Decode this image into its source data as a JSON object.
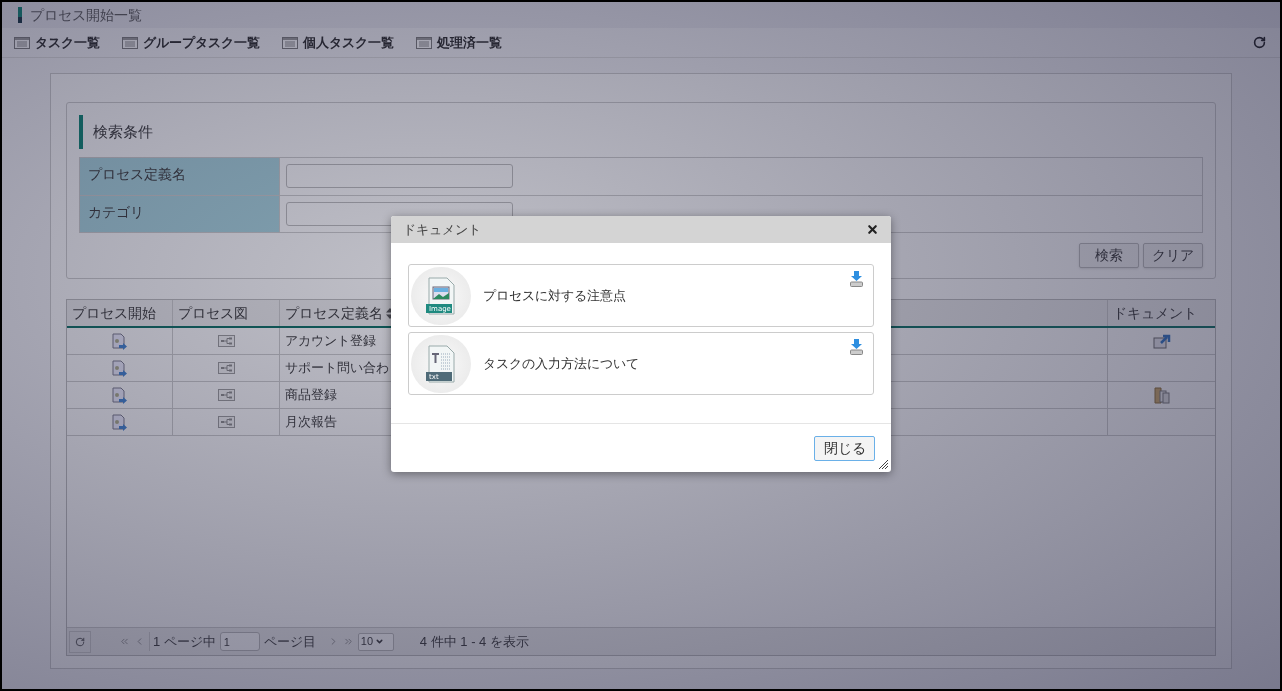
{
  "header": {
    "title": "プロセス開始一覧"
  },
  "toolbar": {
    "links": [
      "タスク一覧",
      "グループタスク一覧",
      "個人タスク一覧",
      "処理済一覧"
    ]
  },
  "search": {
    "title": "検索条件",
    "fields": [
      {
        "label": "プロセス定義名"
      },
      {
        "label": "カテゴリ"
      }
    ],
    "buttons": [
      "検索",
      "クリア"
    ]
  },
  "table": {
    "columns": [
      {
        "label": "プロセス開始",
        "sortable": false
      },
      {
        "label": "プロセス図",
        "sortable": false
      },
      {
        "label": "プロセス定義名",
        "sortable": true
      },
      {
        "label": "ドキュメント",
        "sortable": false
      }
    ],
    "rows": [
      {
        "name": "アカウント登録",
        "kind": "link"
      },
      {
        "name": "サポート問い合わ",
        "kind": "none"
      },
      {
        "name": "商品登録",
        "kind": "folder"
      },
      {
        "name": "月次報告",
        "kind": "none"
      }
    ]
  },
  "pager": {
    "page_info": "1 ページ中",
    "page_input": "1",
    "page_suffix": "ページ目",
    "page_size": "10",
    "summary": "4 件中 1 - 4 を表示"
  },
  "dialog": {
    "title": "ドキュメント",
    "documents": [
      {
        "name": "プロセスに対する注意点",
        "kind": "image",
        "badge": "Image"
      },
      {
        "name": "タスクの入力方法について",
        "kind": "text",
        "badge": "txt"
      }
    ],
    "close_button": "閉じる"
  }
}
